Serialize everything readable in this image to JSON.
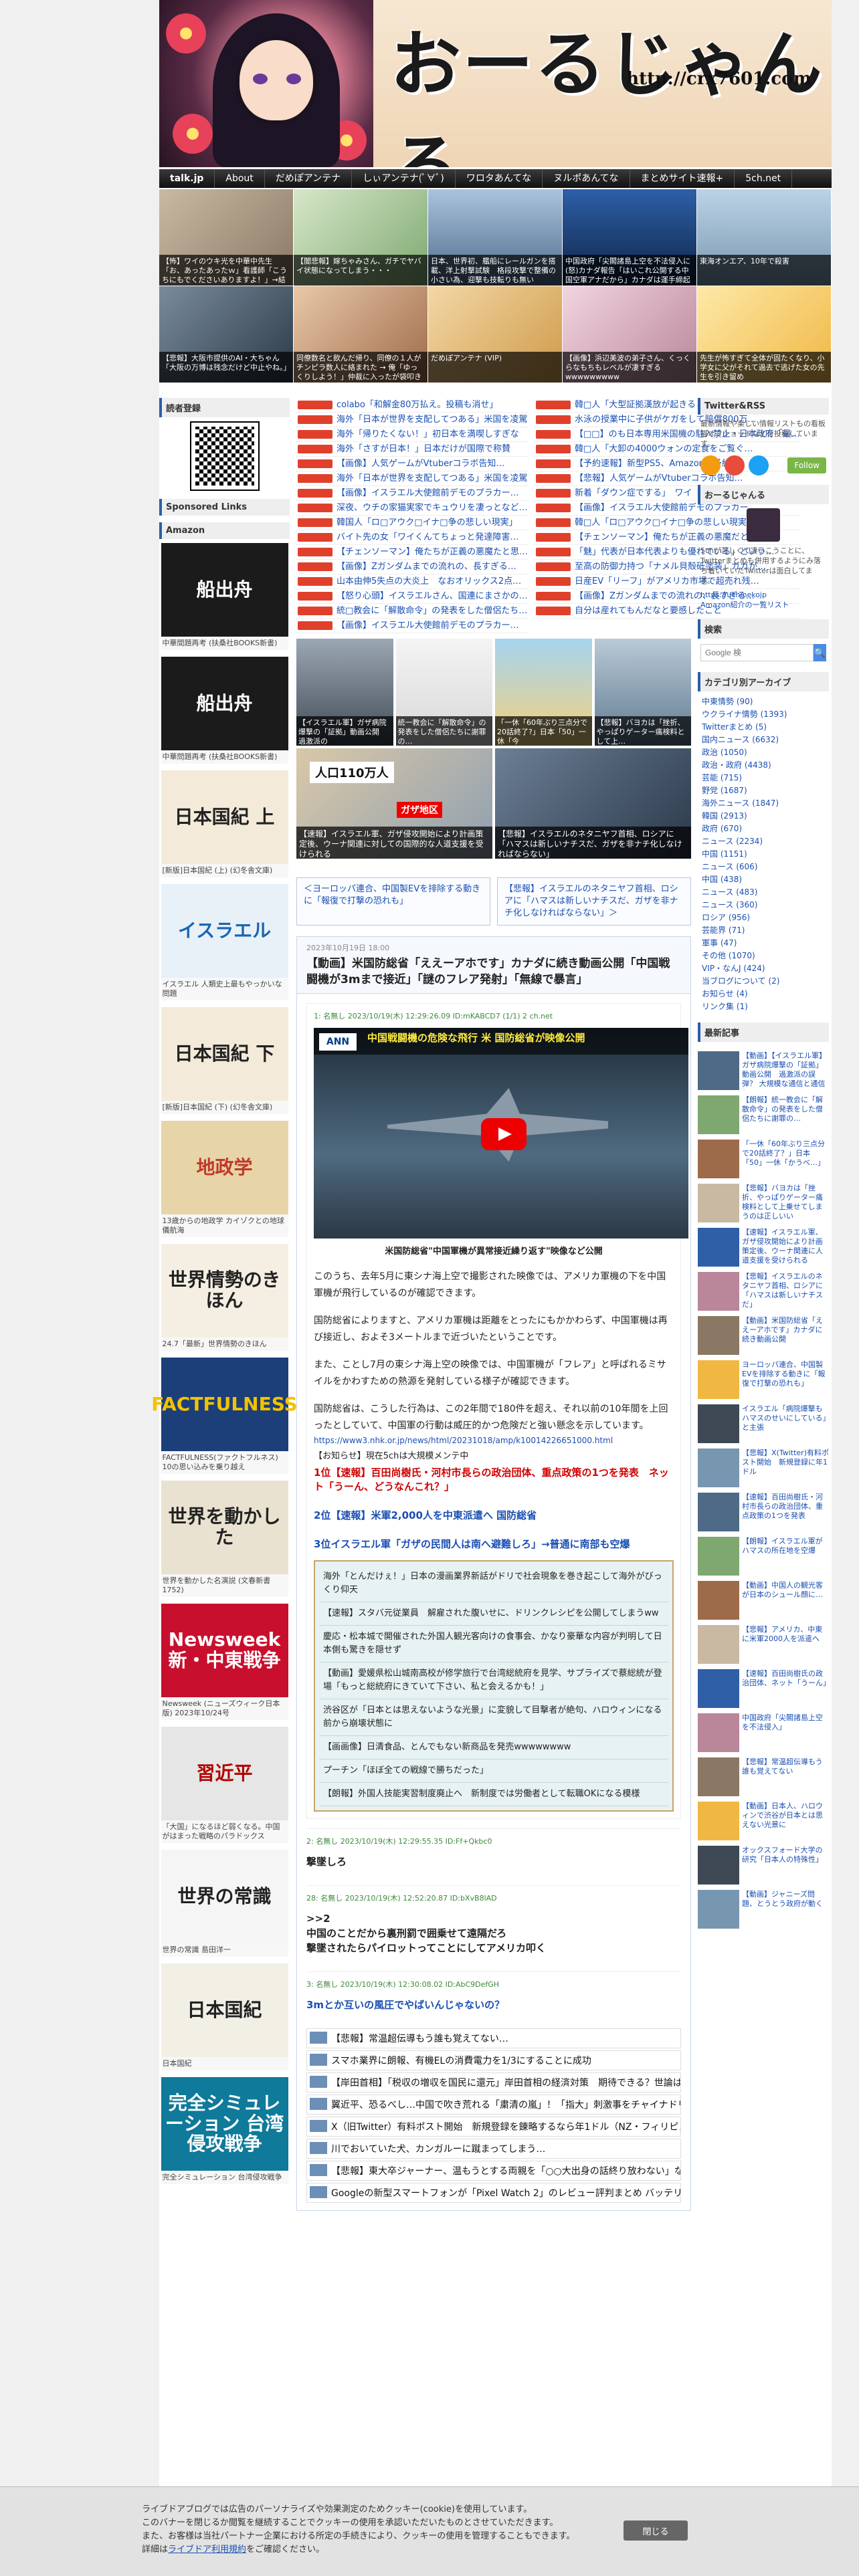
{
  "site": {
    "title": "おーるじゃんる",
    "url": "http://crx7601.com"
  },
  "nav": [
    "talk.jp",
    "About",
    "だめぽアンテナ",
    "しぃアンテナ(ﾟ∀ﾟ)",
    "ワロタあんてな",
    "ヌルポあんてな",
    "まとめサイト速報+",
    "5ch.net"
  ],
  "thumbs": [
    "【怖】ワイのウキ光を中華中先生「お、あったあったｗ」看護師「こうちにもでくださいありますよ！」→結果",
    "【闇悲報】嫁ちゃみさん、ガチでヤバイ状態になってしまう・・・",
    "日本、世界初、艦船にレールガンを搭載、洋上射撃試験　格段攻撃で整備の小さい為、迎撃も技転りも無い",
    "中国政府「尖閣諸島上空を不法侵入に(怒)カナダ報告「はいこれ公開する中国空軍アナだから」カナダは運手締起戦航空",
    "東海オンエア、10年で殺害",
    "【悲報】大阪市提供のAI・大ちゃん「大阪の万博は残念だけど中止やね。」",
    "同僚数名と飲んだ帰り、同僚の１人がチンピラ数人に絡まれた → 俺「ゆっくりしよう！」仲裁に入ったが袋叩きに",
    "だめぽアンテナ (VIP)",
    "【画像】浜辺美波の弟子さん、くっくらなもちもレベルが凄すぎるwwwwwwwww",
    "先生が怖すぎて全体が固たくなり、小学女に父がそれて過去で逃げた女の先生を引き留め"
  ],
  "left": {
    "reader_head": "読者登録",
    "sponsored_head": "Sponsored Links",
    "amazon_head": "Amazon",
    "books": [
      {
        "cover": "船出舟",
        "label": "中華間題再考 (扶桑社BOOKS新書)"
      },
      {
        "cover": "船出舟",
        "label": "中華問題再考 (扶桑社BOOKS新書)"
      },
      {
        "cover": "日本国紀 上",
        "label": "[新版]日本国紀 (上) (幻冬舎文庫)"
      },
      {
        "cover": "イスラエル",
        "label": "イスラエル 人類史上最もやっかいな問題"
      },
      {
        "cover": "日本国紀 下",
        "label": "[新版]日本国紀 (下) (幻冬舎文庫)"
      },
      {
        "cover": "地政学",
        "label": "13歳からの地政学 カイゾクとの地球儀航海"
      },
      {
        "cover": "世界情勢のきほん",
        "label": "24.7「最新」世界情勢のきほん"
      },
      {
        "cover": "FACTFULNESS",
        "label": "FACTFULNESS(ファクトフルネス) 10の思い込みを乗り越え"
      },
      {
        "cover": "世界を動かした",
        "label": "世界を動かした名演説 (文春新書 1752)"
      },
      {
        "cover": "Newsweek 新・中東戦争",
        "label": "Newsweek (ニューズウィーク日本版) 2023年10/24号"
      },
      {
        "cover": "習近平",
        "label": "「大国」になるほど弱くなる。中国がはまった戦略のパラドックス"
      },
      {
        "cover": "世界の常識",
        "label": "世界の常識 島田洋一"
      },
      {
        "cover": "日本国紀",
        "label": "日本国紀"
      },
      {
        "cover": "完全シミュレーション 台湾侵攻戦争",
        "label": "完全シミュレーション 台湾侵攻戦争"
      }
    ]
  },
  "center": {
    "links_left": [
      "colabo「和解金80万払え。投稿も消せ」",
      "海外「日本が世界を支配してつある」米国を凌駕",
      "海外「帰りたくない！」初日本を満喫しすぎな",
      "海外「さすが日本！」日本だけが国際で称賛",
      "【画像】人気ゲームがVtuberコラボ告知…",
      "海外「日本が世界を支配してつある」米国を凌駕",
      "【画像】イスラエル大使館前デモのプラカー…",
      "深夜、ウチの家猫実家でキュウリを凄っとなど…",
      "韓国人「ロ□アウク□イナ□争の悲しい現実」",
      "バイト先の女「ワイくんてちょっと発達障害…",
      "【チェンソーマン】俺たちが正義の悪魔たと思…",
      "【画像】Zガンダムまでの流れの、長すぎる…",
      "山本由伸5失点の大炎上　なおオリックス2点…",
      "【怒り心頭】イスラエルさん、国連にまさかの…",
      "統□教会に「解散命令」の発表をした僧侶たち…",
      "【画像】イスラエル大使館前デモのプラカー…"
    ],
    "links_right": [
      "韓□人「大型証拠漢放が起きるところだった了…",
      "水泳の授業中に子供がケガをして賠償800万…",
      "【□□】のも日本専用米国機の駐入禁止・日本政府「最…",
      "韓□人「大卸の4000ウォンの定食をご覧ぐ…",
      "【予約速報】新型PS5、Amazonで予約…",
      "【悲報】人気ゲームがVtuberコラボ告知…",
      "新着「ダウン症でする」　ワイ「なるそらや…",
      "【画像】イスラエル大使館前デモのプラカー…",
      "韓□人「ロ□アウク□イナ□争の悲しい現実」",
      "【チェンソーマン】俺たちが正義の悪魔だと思…",
      "「魅」代表が日本代表よりも優れている」という…",
      "至高の防御力持つ「ナメル貝殻砥塗装」ガガが…",
      "日産EV「リーフ」がアメリカ市場で超売れ残…",
      "【画像】Zガンダムまでの流れの、長すぎる…",
      "自分は産れてもんだなと要感したこと"
    ],
    "img_row1": [
      "【イスラエル軍】ガザ病院爆撃の「証拠」動画公開　過激派の",
      "統一教会に「解散命令」の発表をした僧侶たちに謝罪の…",
      "「一休「60年ぶり三点分で20話終了?」日本「50」一休「今",
      "【悲報】バヨカは「挫折、やっぱりゲーター痛検料として上…"
    ],
    "img_row2": [
      "【速報】イスラエル軍、ガザ侵攻開始により計画策定後、ウーナ関連に対しての国際的な人道支援を受けられる",
      "【悲報】イスラエルのネタニヤフ首相、ロシアに「ハマスは新しいナチスだ、ガザを非ナチ化しなければならない」"
    ],
    "img_overlay": "人口110万人",
    "img_overlay2": "ガザ地区",
    "prev": "＜ヨーロッパ連合、中国製EVを排除する動きに「報復で打撃の恐れも」",
    "next": "【悲報】イスラエルのネタニヤフ首相、ロシアに「ハマスは新しいナチスだ、ガザを非ナチ化しなければならない」＞",
    "article": {
      "date": "2023年10月19日 18:00",
      "title": "【動画】米国防総省「ええーアホです」カナダに続き動画公開「中国戦闘機が3mまで接近」「謎のフレア発射」「無線で暴言」",
      "post_meta": "1: 名無し 2023/10/19(木) 12:29:26.09 ID:mKABCD7 (1/1) 2 ch.net",
      "video_title": "中国戦闘機の危険な飛行 米 国防総省が映像公開",
      "video_channel": "ANN",
      "video_caption": "米国防総省\"中国軍機が異常接近繰り返す\"映像など公開",
      "paragraphs": [
        "このうち、去年5月に東シナ海上空で撮影された映像では、アメリカ軍機の下を中国軍機が飛行しているのが確認できます。",
        "国防総省によりますと、アメリカ軍機は距離をとったにもかかわらず、中国軍機は再び接近し、およそ3メートルまで近づいたということです。",
        "また、ことし7月の東シナ海上空の映像では、中国軍機が「フレア」と呼ばれるミサイルをかわすための熱源を発射している様子が確認できます。",
        "国防総省は、こうした行為は、この2年間で180件を超え、それ以前の10年間を上回ったとしていて、中国軍の行動は威圧的かつ危険だと強い懸念を示しています。"
      ],
      "source_url": "https://www3.nhk.or.jp/news/html/20231018/amp/k10014226651000.html",
      "recommend_head": "【お知らせ】現在5chは大規模メンテ中",
      "rank1": "1位【速報】百田尚樹氏・河村市長らの政治団体、重点政策の1つを発表　ネット「うーん、どうなんこれ？」",
      "rank2": "2位【速報】米軍2,000人を中東派遣へ 国防総省",
      "rank3": "3位イスラエル軍「ガザの民間人は南へ避難しろ」→普通に南部も空爆",
      "related": [
        "海外「とんだけぇ！」日本の漫画業界新話がドリで社会現象を巻き起こして海外がびっくり仰天",
        "【速報】スタバ元従業員　解雇された腹いせに、ドリンクレシピを公開してしまうww",
        "慶応・松本城で開催された外国人観光客向けの食事会、かなり豪華な内容が判明して日本側も驚きを隠せず",
        "【動画】愛媛県松山城南高校が修学旅行で台湾総統府を見学、サプライズで蔡総統が登場「もっと総統府にきていて下さい、私と会えるかも！」",
        "渋谷区が「日本とは思えないような光景」に変貌して目撃者が絶句、ハロウィンになる前から崩壊状態に",
        "【画画像】日清食品、とんでもない新商品を発売wwwwwwww",
        "プーチン「ほぼ全ての戦線で勝ちだった」",
        "【朗報】外国人技能実習制度廃止へ　新制度では労働者として転職OKになる模様"
      ]
    },
    "comments": [
      {
        "meta": "2: 名無し 2023/10/19(木) 12:29:55.35 ID:Ff+Qkbc0",
        "text": "撃墜しろ",
        "blue": false
      },
      {
        "meta": "28: 名無し 2023/10/19(木) 12:52:20.87 ID:bXvB8lAD",
        "text": ">>2\n中国のことだから裏刑罰で囲乗せて遠隔だろ\n撃墜されたらパイロットってことにしてアメリカ叩く",
        "blue": false
      },
      {
        "meta": "3: 名無し 2023/10/19(木) 12:30:08.02 ID:AbC9DefGH",
        "text": "3mとか互いの風圧でやばいんじゃないの？",
        "blue": true
      }
    ],
    "bottom_links": [
      "【悲報】常温超伝導もう誰も覚えてない…",
      "スマホ業界に朗報、有機ELの消費電力を1/3にすることに成功",
      "【岸田首相】「税収の増収を国民に還元」岸田首相の経済対策　期待できる？世論は",
      "翼近平、恐るべし…中国で吹き荒れる「粛清の嵐」！「指大」刺激事をチャイナドリーマーが次々",
      "X（旧Twitter）有料ポスト開始　新規登録を錬略するなら年1ドル（NZ・フィリピン）",
      "川でおいていた犬、カンガルーに蹴まってしまう…",
      "【悲報】東大卒ジャーナー、温もうとする両親を「○○大出身の話終り放わない」など罵倒…",
      "Googleの新型スマートフォンが「Pixel Watch 2」のレビュー評判まとめ バッテリーの持ちは良くな"
    ]
  },
  "right": {
    "twitter_head": "Twitter&RSS",
    "twitter_text": "最新情報や楽しい情報リストもの看板猫オフショットなどを投稿しています。",
    "follow": "Follow",
    "about_head": "おーるじゃんる",
    "about_text": "5chが苦しくて凄いこうことに、Twitterまとめも併用するようにみ落ち着いていたTwitterは面白してます。",
    "about_link1": "https://uchinekojp",
    "about_link2": "Amazon紹介の一覧リスト",
    "search_head": "検索",
    "search_placeholder": "Google 検",
    "search_button": "🔍",
    "cat_head": "カテゴリ別アーカイブ",
    "categories": [
      "中東情勢 (90)",
      "ウクライナ情勢 (1393)",
      "Twitterまとめ (5)",
      "国内ニュース (6632)",
      "政治 (1050)",
      "政治・政府 (4438)",
      "芸能 (715)",
      "野党 (1687)",
      "海外ニュース (1847)",
      "韓国 (2913)",
      "政府 (670)",
      "ニュース (2234)",
      "中国 (1151)",
      "ニュース (606)",
      "中国 (438)",
      "ニュース (483)",
      "ニュース (360)",
      "ロシア (956)",
      "芸能界 (71)",
      "軍事 (47)",
      "その他 (1070)",
      "VIP・なんJ (424)",
      "当ブログについて (2)",
      "お知らせ (4)",
      "リンク集 (1)"
    ],
    "recent_head": "最新記事",
    "recent": [
      "【動画】【イスラエル軍】ガザ病院爆撃の「証拠」動画公開　過激派の誤弾？ 大規模な通信と通信し",
      "【朗報】統一教会に「解散命令」の発表をした僧侶たちに謝罪の…",
      "「一休「60年ぶり三点分で20話終了？」日本「50」一休「かうべ…」",
      "【悲報】バヨカは「挫折、やっぱりゲーター痛検料として上乗せてしまうのは正しいい",
      "【速報】イスラエル軍、ガザ侵攻開始により計画策定後、ウーナ関連に人道支援を受けられる",
      "【悲報】イスラエルのネタニヤフ首相、ロシアに「ハマスは新しいナチスだ」",
      "【動画】米国防総省「ええーアホです」カナダに続き動画公開",
      "ヨーロッパ連合、中国製EVを排除する動きに「報復で打撃の恐れも」",
      "イスラエル「病院爆撃もハマスのせいにしている」と主張",
      "【悲報】X(Twitter)有料ポスト開始　新規登録に年1ドル",
      "【速報】百田尚樹氏・河村市長らの政治団体、重点政策の1つを発表",
      "【朗報】イスラエル軍がハマスの所在地を空爆",
      "【動画】中国人の観光客が日本のシュール顔に…",
      "【悲報】アメリカ、中東に米軍2000人を派遣へ",
      "【速報】百田尚樹氏の政治団体、ネット「うーん」",
      "中国政府「尖閣諸島上空を不法侵入」",
      "【悲報】常温超伝導もう誰も覚えてない",
      "【動画】日本人、ハロウィンで渋谷が日本とは思えない光景に",
      "オックスフォード大学の研究「日本人の特殊性」",
      "【動画】ジャニーズ問題、とうとう政府が動く"
    ]
  },
  "cookie": {
    "line1": "ライブドアブログでは広告のパーソナライズや効果測定のためクッキー(cookie)を使用しています。",
    "line2": "このバナーを閉じるか閲覧を継続することでクッキーの使用を承認いただいたものとさせていただきます。",
    "line3": "また、お客様は当社パートナー企業における所定の手続きにより、クッキーの使用を管理することもできます。",
    "line4_pre": "詳細は",
    "line4_link": "ライブドア利用規約",
    "line4_post": "をご確認ください。",
    "close": "閉じる"
  },
  "colors": {
    "accent": "#2b5fa7",
    "link": "#1a4fb3",
    "red": "#d10000",
    "related_border": "#c9a36a"
  }
}
